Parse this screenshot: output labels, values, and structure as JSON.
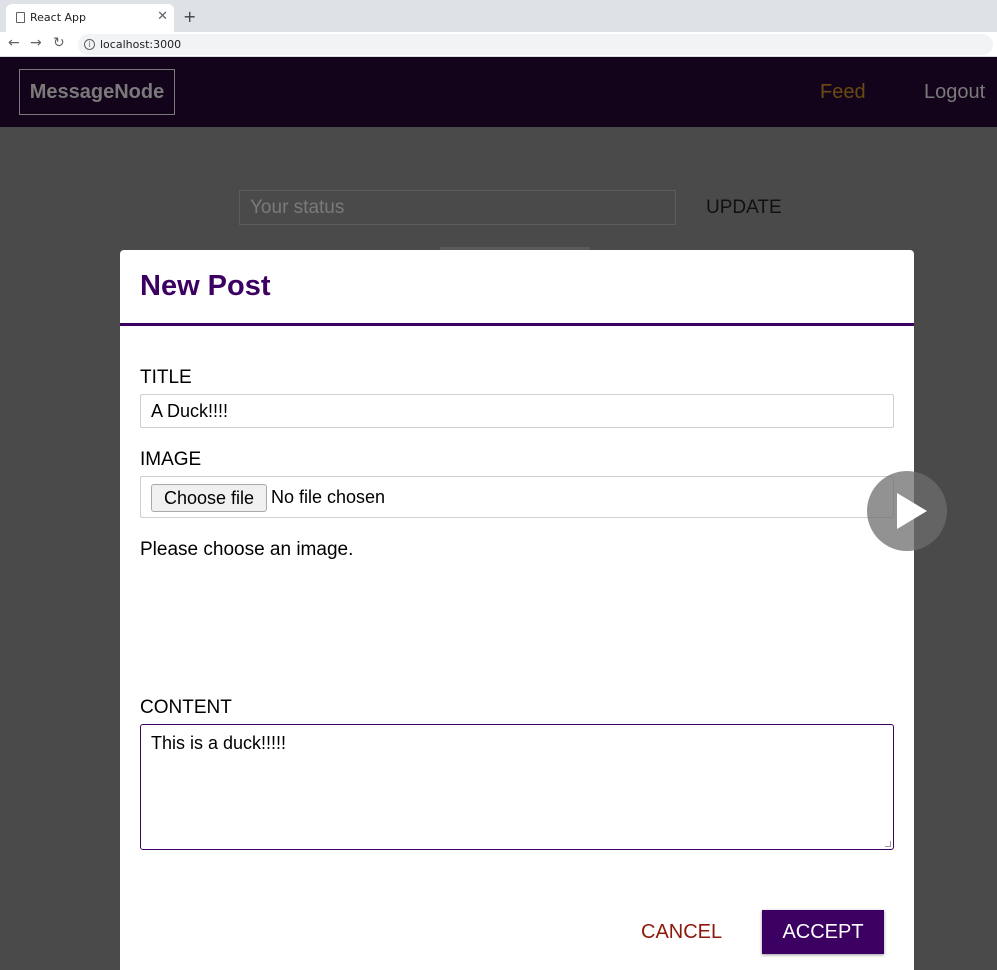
{
  "browser": {
    "tab_title": "React App",
    "close_glyph": "✕",
    "newtab_glyph": "+",
    "url": "localhost:3000",
    "back_glyph": "←",
    "forward_glyph": "→",
    "reload_glyph": "↻",
    "info_glyph": "i"
  },
  "app": {
    "logo": "MessageNode",
    "nav": {
      "feed": "Feed",
      "logout": "Logout"
    },
    "status": {
      "placeholder": "Your status",
      "update_label": "UPDATE"
    }
  },
  "modal": {
    "title": "New Post",
    "fields": {
      "title_label": "TITLE",
      "title_value": "A Duck!!!!",
      "image_label": "IMAGE",
      "choose_file": "Choose file",
      "no_file": "No file chosen",
      "image_message": "Please choose an image.",
      "content_label": "CONTENT",
      "content_value": "This is a duck!!!!!"
    },
    "actions": {
      "cancel": "CANCEL",
      "accept": "ACCEPT"
    }
  },
  "colors": {
    "primary": "#3b0062",
    "cancel": "#8b1a0b",
    "header_bg": "#13041c",
    "feed_accent": "#fab83f"
  },
  "icons": [
    "page-icon",
    "close-icon",
    "plus-icon",
    "back-icon",
    "forward-icon",
    "reload-icon",
    "info-icon",
    "play-icon"
  ]
}
